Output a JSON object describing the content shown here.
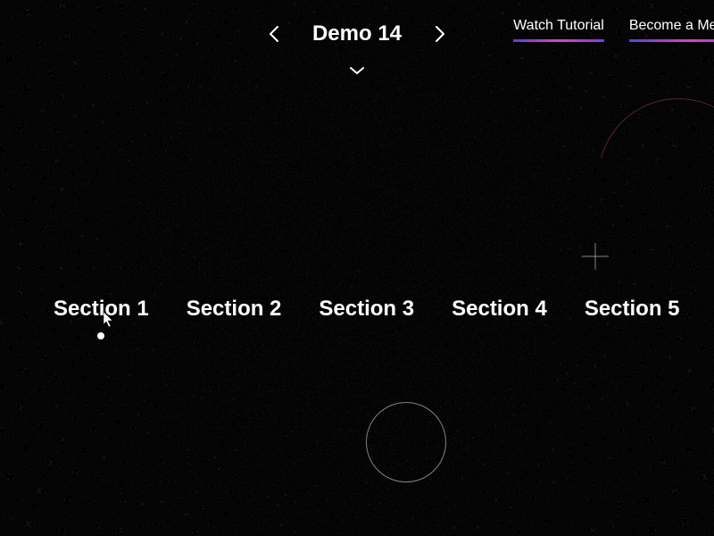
{
  "header": {
    "title": "Demo 14"
  },
  "topLinks": [
    {
      "label": "Watch Tutorial"
    },
    {
      "label": "Become a Member"
    }
  ],
  "sections": [
    {
      "label": "Section 1",
      "active": true
    },
    {
      "label": "Section 2",
      "active": false
    },
    {
      "label": "Section 3",
      "active": false
    },
    {
      "label": "Section 4",
      "active": false
    },
    {
      "label": "Section 5",
      "active": false
    }
  ]
}
